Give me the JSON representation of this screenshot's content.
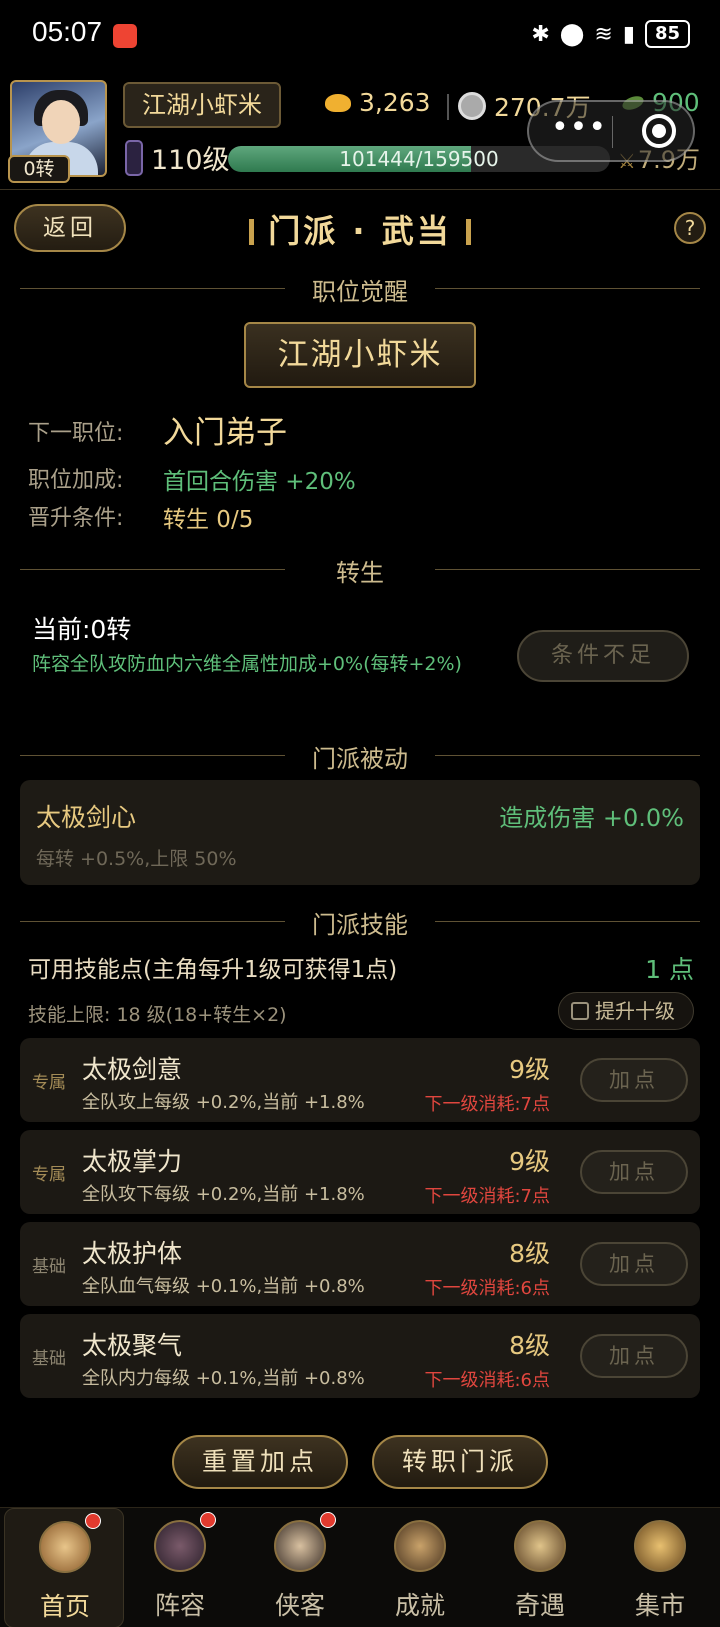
{
  "status": {
    "time": "05:07",
    "battery": "85"
  },
  "player": {
    "rebirth": "0转",
    "name": "江湖小虾米",
    "level": "110级",
    "xp_text": "101444/159500",
    "xp_progress": 0.636
  },
  "currency": {
    "gold": "3,263",
    "silver": "270.7万",
    "jade": "900",
    "power": "7.9万"
  },
  "capsule": {
    "more": "•••"
  },
  "header": {
    "back": "返回",
    "title": "门派 · 武当",
    "help": "?"
  },
  "awaken": {
    "section": "职位觉醒",
    "current_rank": "江湖小虾米",
    "rows": [
      {
        "label": "下一职位:",
        "value": "入门弟子"
      },
      {
        "label": "职位加成:",
        "value": "首回合伤害 +20%"
      },
      {
        "label": "晋升条件:",
        "value": "转生 0/5"
      }
    ]
  },
  "rebirth": {
    "section": "转生",
    "current": "当前:0转",
    "desc": "阵容全队攻防血内六维全属性加成+0%(每转+2%)",
    "button": "条件不足"
  },
  "passive": {
    "section": "门派被动",
    "name": "太极剑心",
    "bonus": "造成伤害 +0.0%",
    "note": "每转 +0.5%,上限 50%"
  },
  "skills": {
    "section": "门派技能",
    "points_label": "可用技能点(主角每升1级可获得1点)",
    "points_value": "1 点",
    "cap": "技能上限: 18 级(18+转生×2)",
    "toggle_label": "提升十级",
    "items": [
      {
        "tag": "专属",
        "name": "太极剑意",
        "desc": "全队攻上每级 +0.2%,当前 +1.8%",
        "level": "9级",
        "cost": "下一级消耗:7点",
        "button": "加点"
      },
      {
        "tag": "专属",
        "name": "太极掌力",
        "desc": "全队攻下每级 +0.2%,当前 +1.8%",
        "level": "9级",
        "cost": "下一级消耗:7点",
        "button": "加点"
      },
      {
        "tag": "基础",
        "name": "太极护体",
        "desc": "全队血气每级 +0.1%,当前 +0.8%",
        "level": "8级",
        "cost": "下一级消耗:6点",
        "button": "加点"
      },
      {
        "tag": "基础",
        "name": "太极聚气",
        "desc": "全队内力每级 +0.1%,当前 +0.8%",
        "level": "8级",
        "cost": "下一级消耗:6点",
        "button": "加点"
      }
    ]
  },
  "actions": {
    "reset": "重置加点",
    "transfer": "转职门派"
  },
  "tabs": [
    {
      "label": "首页",
      "icon": "home-icon",
      "dot": true
    },
    {
      "label": "阵容",
      "icon": "lineup-icon",
      "dot": true
    },
    {
      "label": "侠客",
      "icon": "hero-icon",
      "dot": true
    },
    {
      "label": "成就",
      "icon": "book-icon",
      "dot": false
    },
    {
      "label": "奇遇",
      "icon": "adventure-icon",
      "dot": false
    },
    {
      "label": "集市",
      "icon": "market-icon",
      "dot": false
    }
  ]
}
